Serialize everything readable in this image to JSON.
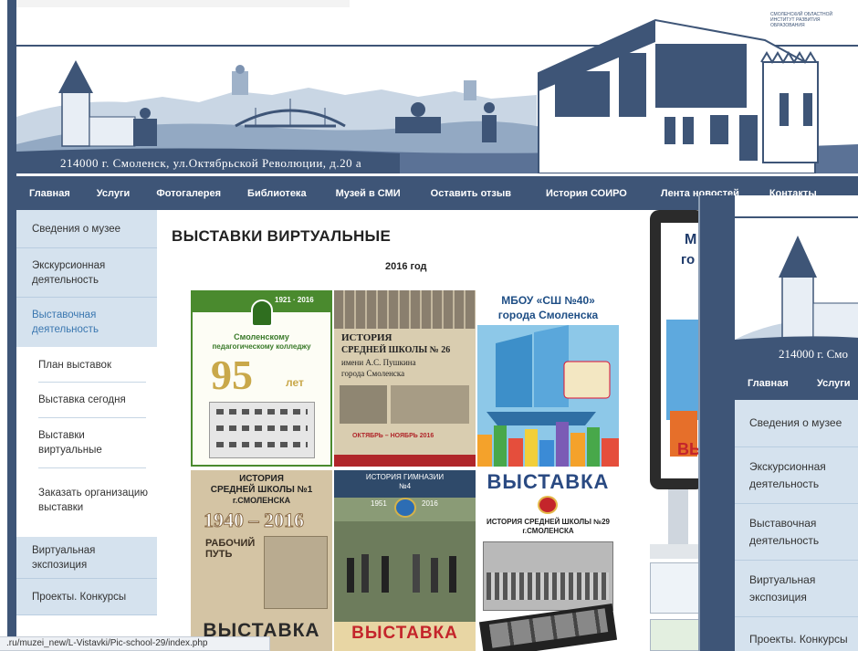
{
  "header": {
    "address": "214000 г. Смоленск, ул.Октябрьской Революции, д.20 а",
    "logo_text": "СМОЛЕНСКИЙ ОБЛАСТНОЙ ИНСТИТУТ РАЗВИТИЯ ОБРАЗОВАНИЯ"
  },
  "nav": {
    "items": [
      "Главная",
      "Услуги",
      "Фотогалерея",
      "Библиотека",
      "Музей в СМИ",
      "Оставить отзыв",
      "История СОИРО",
      "Лента новостей",
      "Контакты"
    ]
  },
  "sidebar": {
    "items": [
      "Сведения о музее",
      "Экскурсионная деятельность",
      "Выставочная деятельность",
      "Виртуальная экспозиция",
      "Проекты. Конкурсы"
    ],
    "sub_items": [
      "План выставок",
      "Выставка сегодня",
      "Выставки виртуальные",
      "Заказать организацию выставки"
    ]
  },
  "main": {
    "title": "ВЫСТАВКИ ВИРТУАЛЬНЫЕ",
    "year": "2016 год",
    "posters": {
      "p1": {
        "year_range": "1921 · 2016",
        "line1": "Смоленскому",
        "line2": "педагогическому колледжу",
        "big": "95",
        "suffix": "лет"
      },
      "p2": {
        "line1": "ИСТОРИЯ",
        "line2": "СРЕДНЕЙ ШКОЛЫ № 26",
        "line3": "имени А.С. Пушкина",
        "line4": "города Смоленска",
        "date": "ОКТЯБРЬ – НОЯБРЬ 2016"
      },
      "p3": {
        "line1": "МБОУ «СШ №40»",
        "line2": "города Смоленска"
      },
      "p4": {
        "line1": "ИСТОРИЯ",
        "line2": "СРЕДНЕЙ ШКОЛЫ №1",
        "line3": "г.СМОЛЕНСКА",
        "years": "1940 – 2016",
        "sub": "РАБОЧИЙ ПУТЬ",
        "big": "ВЫСТАВКА"
      },
      "p5": {
        "line1": "ИСТОРИЯ ГИМНАЗИИ",
        "line2": "№4",
        "y1": "1951",
        "y2": "2016",
        "big": "ВЫСТАВКА"
      },
      "p6": {
        "big": "ВЫСТАВКА",
        "line1": "ИСТОРИЯ СРЕДНЕЙ ШКОЛЫ №29",
        "line2": "г.СМОЛЕНСКА"
      }
    }
  },
  "kiosk": {
    "letters1": "М",
    "letters2": "го",
    "letters3": "ВЬ"
  },
  "overlay": {
    "address": "214000 г. Смо",
    "nav": [
      "Главная",
      "Услуги"
    ],
    "items": [
      "Сведения о музее",
      "Экскурсионная деятельность",
      "Выставочная деятельность",
      "Виртуальная экспозиция",
      "Проекты. Конкурсы"
    ]
  },
  "status_bar": {
    "url": ".ru/muzei_new/L-Vistavki/Pic-school-29/index.php"
  },
  "colors": {
    "nav_bg": "#3e5577",
    "sidebar_bg": "#d5e2ee",
    "active_link": "#3a77b0"
  }
}
